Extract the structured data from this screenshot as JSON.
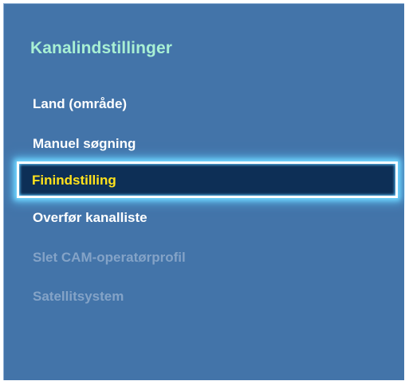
{
  "panel": {
    "title": "Kanalindstillinger"
  },
  "menu": {
    "items": [
      {
        "label": "Land (område)",
        "enabled": true,
        "selected": false
      },
      {
        "label": "Manuel søgning",
        "enabled": true,
        "selected": false
      },
      {
        "label": "Finindstilling",
        "enabled": true,
        "selected": true
      },
      {
        "label": "Overfør kanalliste",
        "enabled": true,
        "selected": false
      },
      {
        "label": "Slet CAM-operatørprofil",
        "enabled": false,
        "selected": false
      },
      {
        "label": "Satellitsystem",
        "enabled": false,
        "selected": false
      }
    ]
  },
  "colors": {
    "panel_background": "#4374a9",
    "title": "#a8f0d4",
    "item_text": "#ffffff",
    "item_disabled": "#84a3c7",
    "selected_background": "#0d2f56",
    "selected_text": "#ffe21c",
    "focus_glow": "#72d8ff"
  }
}
